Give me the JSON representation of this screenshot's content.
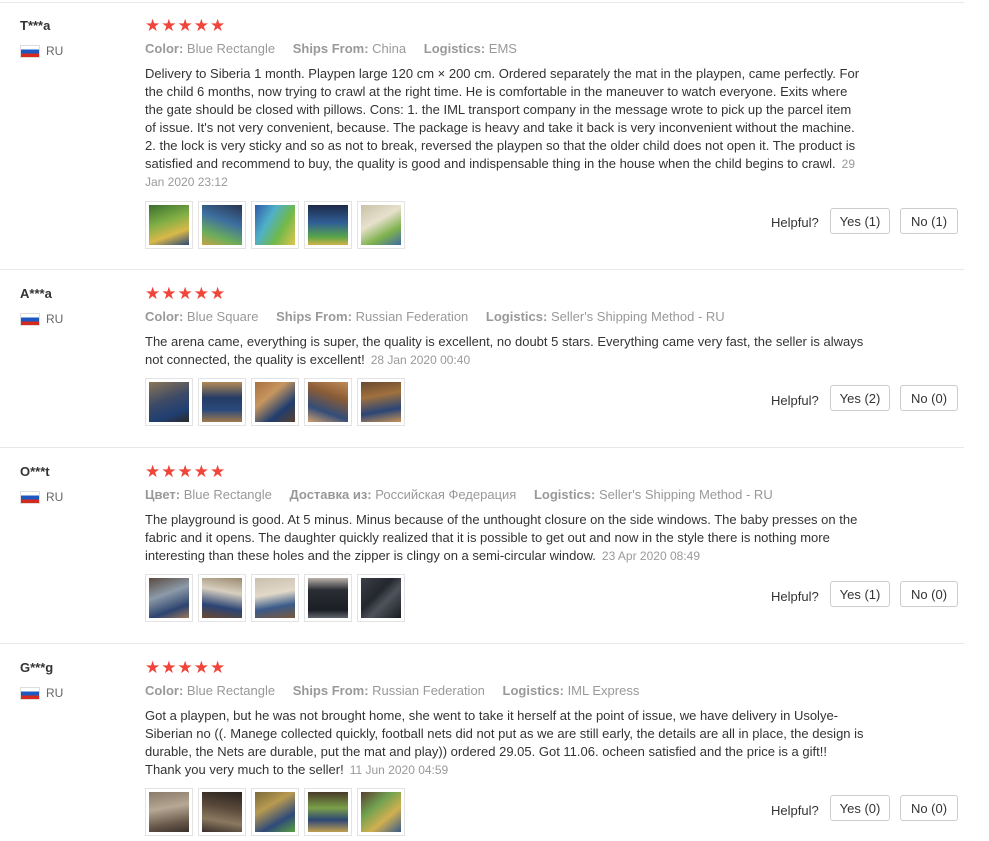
{
  "reviews": [
    {
      "user": "T***a",
      "country": "RU",
      "stars": "★★★★★",
      "props": [
        {
          "label": "Color:",
          "value": "Blue Rectangle"
        },
        {
          "label": "Ships From:",
          "value": "China"
        },
        {
          "label": "Logistics:",
          "value": "EMS"
        }
      ],
      "text": "Delivery to Siberia 1 month. Playpen large 120 cm × 200 cm. Ordered separately the mat in the playpen, came perfectly. For the child 6 months, now trying to crawl at the right time. He is comfortable in the maneuver to watch everyone. Exits where the gate should be closed with pillows. Cons: 1. the IML transport company in the message wrote to pick up the parcel item of issue. It's not very convenient, because. The package is heavy and take it back is very inconvenient without the machine. 2. the lock is very sticky and so as not to break, reversed the playpen so that the older child does not open it. The product is satisfied and recommend to buy, the quality is good and indispensable thing in the house when the child begins to crawl.",
      "date": "29 Jan 2020 23:12",
      "helpful_label": "Helpful?",
      "yes_label": "Yes (1)",
      "no_label": "No (1)"
    },
    {
      "user": "A***a",
      "country": "RU",
      "stars": "★★★★★",
      "props": [
        {
          "label": "Color:",
          "value": "Blue Square"
        },
        {
          "label": "Ships From:",
          "value": "Russian Federation"
        },
        {
          "label": "Logistics:",
          "value": "Seller's Shipping Method - RU"
        }
      ],
      "text": "The arena came, everything is super, the quality is excellent, no doubt 5 stars. Everything came very fast, the seller is always not connected, the quality is excellent!",
      "date": "28 Jan 2020 00:40",
      "helpful_label": "Helpful?",
      "yes_label": "Yes (2)",
      "no_label": "No (0)"
    },
    {
      "user": "O***t",
      "country": "RU",
      "stars": "★★★★★",
      "props": [
        {
          "label": "Цвет:",
          "value": "Blue Rectangle"
        },
        {
          "label": "Доставка из:",
          "value": "Российская Федерация"
        },
        {
          "label": "Logistics:",
          "value": "Seller's Shipping Method - RU"
        }
      ],
      "text": "The playground is good. At 5 minus. Minus because of the unthought closure on the side windows. The baby presses on the fabric and it opens. The daughter quickly realized that it is possible to get out and now in the style there is nothing more interesting than these holes and the zipper is clingy on a semi-circular window.",
      "date": "23 Apr 2020 08:49",
      "helpful_label": "Helpful?",
      "yes_label": "Yes (1)",
      "no_label": "No (0)"
    },
    {
      "user": "G***g",
      "country": "RU",
      "stars": "★★★★★",
      "props": [
        {
          "label": "Color:",
          "value": "Blue Rectangle"
        },
        {
          "label": "Ships From:",
          "value": "Russian Federation"
        },
        {
          "label": "Logistics:",
          "value": "IML Express"
        }
      ],
      "text": "Got a playpen, but he was not brought home, she went to take it herself at the point of issue, we have delivery in Usolye-Siberian no ((. Manege collected quickly, football nets did not put as we are still early, the details are all in place, the design is durable, the Nets are durable, put the mat and play)) ordered 29.05. Got 11.06. ocheen satisfied and the price is a gift!! Thank you very much to the seller!",
      "date": "11 Jun 2020 04:59",
      "helpful_label": "Helpful?",
      "yes_label": "Yes (0)",
      "no_label": "No (0)"
    }
  ],
  "colors": {
    "star": "#f0453a",
    "meta": "#999999",
    "text": "#333333"
  }
}
